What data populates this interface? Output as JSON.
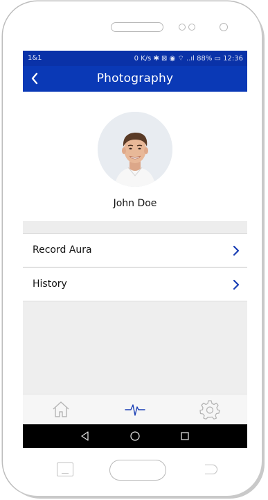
{
  "status_bar": {
    "carrier": "1&1",
    "indicators": "0 K/s ✱ ⊠ ◉ ⌔ ..ıl 88% ▭ 12:36"
  },
  "app_bar": {
    "title": "Photography",
    "back_icon": "chevron-left-icon"
  },
  "profile": {
    "name": "John Doe",
    "avatar_icon": "user-photo"
  },
  "menu": {
    "items": [
      {
        "label": "Record Aura",
        "icon": "chevron-right-icon"
      },
      {
        "label": "History",
        "icon": "chevron-right-icon"
      }
    ]
  },
  "tab_bar": {
    "tabs": [
      {
        "name": "home",
        "icon": "home-icon",
        "active": false
      },
      {
        "name": "pulse",
        "icon": "pulse-icon",
        "active": true
      },
      {
        "name": "settings",
        "icon": "gear-icon",
        "active": false
      }
    ]
  },
  "system_nav": {
    "buttons": [
      "back-triangle-icon",
      "home-circle-icon",
      "recent-square-icon"
    ]
  },
  "colors": {
    "primary": "#0a39b6",
    "status_bar": "#0a32a8",
    "active_tab": "#1a3fb5",
    "inactive_tab": "#b5b5b5",
    "background": "#efefef"
  }
}
